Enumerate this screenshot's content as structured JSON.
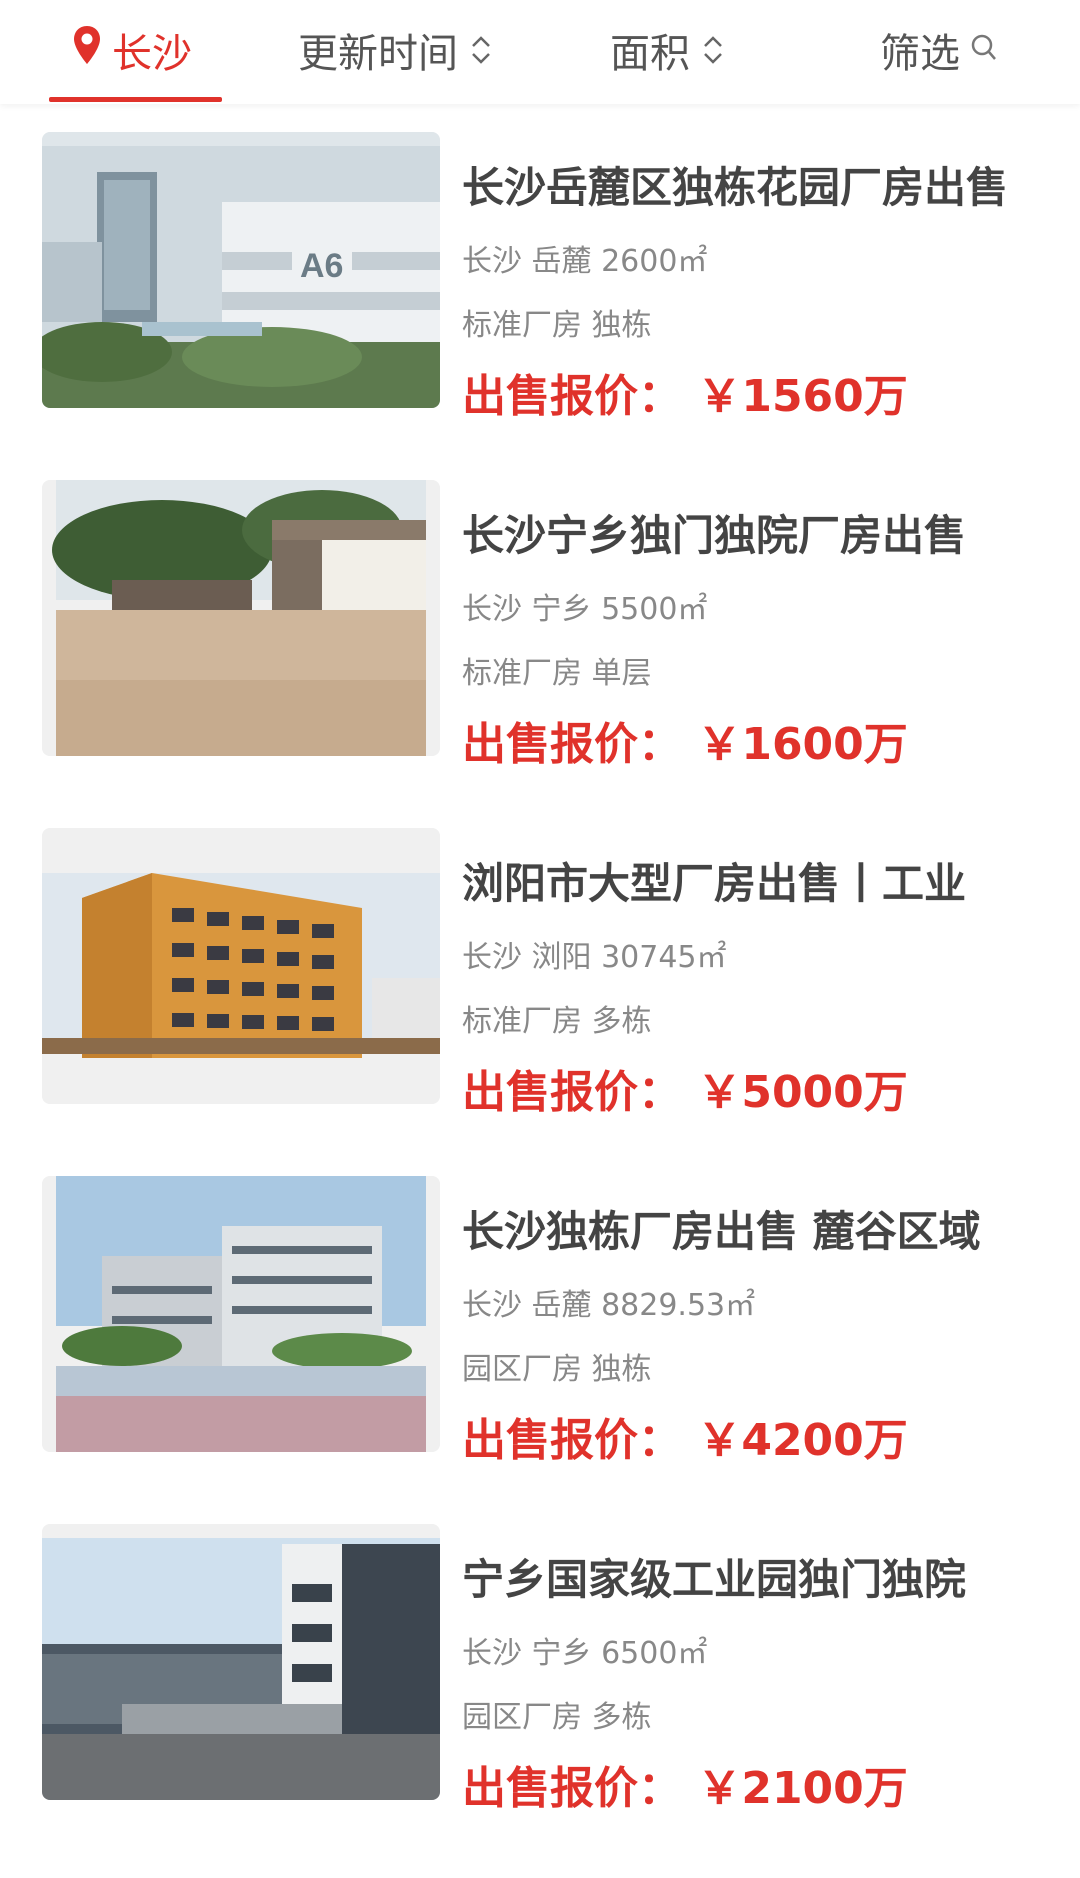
{
  "filter_bar": {
    "city": "长沙",
    "update_time": "更新时间",
    "area": "面积",
    "screen": "筛选"
  },
  "colors": {
    "accent": "#e0322b",
    "text_gray": "#888888",
    "title_gray": "#444444"
  },
  "listings": [
    {
      "title": "长沙岳麓区独栋花园厂房出售",
      "meta": "长沙 岳麓 2600㎡",
      "tags": "标准厂房 独栋",
      "price_label": "出售报价：",
      "price_value": "￥1560万",
      "image": "modern-industrial-park-photo",
      "image_text": "A6"
    },
    {
      "title": "长沙宁乡独门独院厂房出售",
      "meta": "长沙 宁乡 5500㎡",
      "tags": "标准厂房 单层",
      "price_label": "出售报价：",
      "price_value": "￥1600万",
      "image": "factory-courtyard-photo"
    },
    {
      "title": "浏阳市大型厂房出售丨工业",
      "meta": "长沙 浏阳 30745㎡",
      "tags": "标准厂房 多栋",
      "price_label": "出售报价：",
      "price_value": "￥5000万",
      "image": "orange-factory-building-photo"
    },
    {
      "title": "长沙独栋厂房出售 麓谷区域",
      "meta": "长沙 岳麓 8829.53㎡",
      "tags": "园区厂房 独栋",
      "price_label": "出售报价：",
      "price_value": "￥4200万",
      "image": "white-office-buildings-photo"
    },
    {
      "title": "宁乡国家级工业园独门独院",
      "meta": "长沙 宁乡 6500㎡",
      "tags": "园区厂房 多栋",
      "price_label": "出售报价：",
      "price_value": "￥2100万",
      "image": "industrial-gate-photo"
    }
  ]
}
